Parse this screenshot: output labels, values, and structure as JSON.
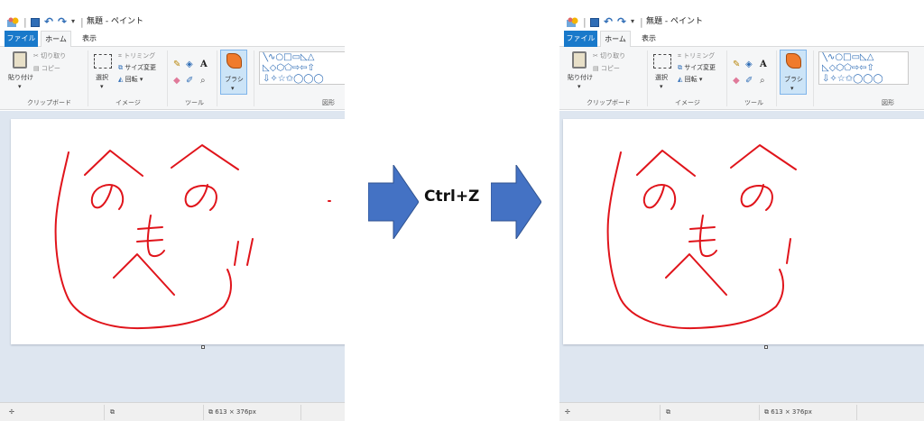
{
  "before": {
    "title": "無題 - ペイント",
    "tabs": [
      "ファイル",
      "ホーム",
      "表示"
    ],
    "ribbon": {
      "paste": "貼り付け",
      "cut": "切り取り",
      "copy": "コピー",
      "clipboard_group": "クリップボード",
      "select": "選択",
      "crop": "トリミング",
      "resize": "サイズ変更",
      "rotate": "回転 ▾",
      "image_group": "イメージ",
      "tools_group": "ツール",
      "brush": "ブラシ",
      "shapes_group": "図形"
    },
    "status": {
      "size_label": "613 × 376px"
    }
  },
  "after": {
    "title": "無題 - ペイント",
    "tabs": [
      "ファイル",
      "ホーム",
      "表示"
    ],
    "ribbon": {
      "paste": "貼り付け",
      "cut": "切り取り",
      "copy": "コピー",
      "clipboard_group": "クリップボード",
      "select": "選択",
      "crop": "トリミング",
      "resize": "サイズ変更",
      "rotate": "回転 ▾",
      "image_group": "イメージ",
      "tools_group": "ツール",
      "brush": "ブラシ",
      "shapes_group": "図形"
    },
    "status": {
      "size_label": "613 × 376px"
    }
  },
  "shortcut_label": "Ctrl+Z",
  "colors": {
    "stroke": "#e0141b",
    "arrow": "#4472c4",
    "canvas_bg": "#dee6f0",
    "tab_file": "#1979ca"
  },
  "icons": [
    "paint-app-icon",
    "save-icon",
    "undo-icon",
    "redo-icon",
    "paste-icon",
    "brush-icon",
    "move-icon",
    "selection-icon",
    "arrow-right-icon"
  ]
}
